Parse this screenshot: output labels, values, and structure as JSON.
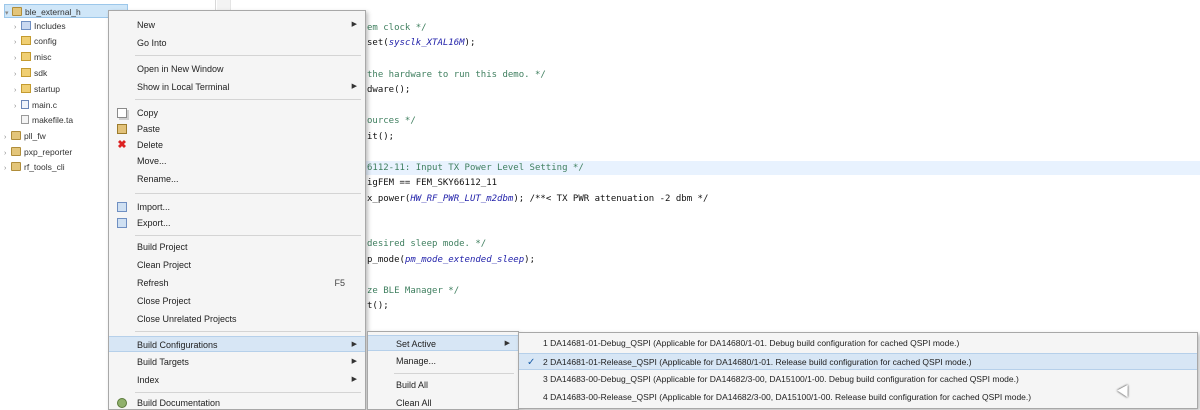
{
  "explorer": {
    "items": [
      {
        "label": "ble_external_h",
        "icon": "project-icon",
        "twisty": "▾"
      },
      {
        "label": "Includes",
        "icon": "include-icon",
        "twisty": "›"
      },
      {
        "label": "config",
        "icon": "folder-icon",
        "twisty": "›"
      },
      {
        "label": "misc",
        "icon": "folder-icon",
        "twisty": "›"
      },
      {
        "label": "sdk",
        "icon": "folder-icon",
        "twisty": "›"
      },
      {
        "label": "startup",
        "icon": "folder-icon",
        "twisty": "›"
      },
      {
        "label": "main.c",
        "icon": "c-file-icon",
        "twisty": "›"
      },
      {
        "label": "makefile.ta",
        "icon": "file-icon",
        "twisty": ""
      },
      {
        "label": "pll_fw",
        "icon": "project-icon",
        "twisty": "›"
      },
      {
        "label": "pxp_reporter",
        "icon": "project-icon",
        "twisty": "›"
      },
      {
        "label": "rf_tools_cli",
        "icon": "project-icon",
        "twisty": "›"
      }
    ]
  },
  "editor": {
    "lines": [
      {
        "text": "em clock */",
        "kind": "comment"
      },
      {
        "text": "set(",
        "kw": "sysclk_XTAL16M",
        "tail": ");",
        "kind": "code"
      },
      {
        "text": "",
        "kind": "code"
      },
      {
        "text": "the hardware to run this demo. */",
        "kind": "comment"
      },
      {
        "text": "dware();",
        "kind": "code"
      },
      {
        "text": "",
        "kind": "code"
      },
      {
        "text": "ources */",
        "kind": "comment"
      },
      {
        "text": "it();",
        "kind": "code"
      },
      {
        "text": "",
        "kind": "code"
      },
      {
        "text": "6112-11: Input TX Power Level Setting */",
        "kind": "comment",
        "highlight": true
      },
      {
        "text": "igFEM == FEM_SKY66112_11",
        "kind": "code"
      },
      {
        "text": "x_power(",
        "kw": "HW_RF_PWR_LUT_m2dbm",
        "tail": "); /**< TX PWR attenuation -2 dbm */",
        "kind": "code"
      },
      {
        "text": "",
        "kind": "code"
      },
      {
        "text": "",
        "kind": "code"
      },
      {
        "text": "desired sleep mode. */",
        "kind": "comment"
      },
      {
        "text": "p_mode(",
        "kw": "pm_mode_extended_sleep",
        "tail": ");",
        "kind": "code"
      },
      {
        "text": "",
        "kind": "code"
      },
      {
        "text": "ze BLE Manager */",
        "kind": "comment"
      },
      {
        "text": "t();",
        "kind": "code"
      }
    ]
  },
  "context_menu": {
    "items": [
      {
        "label": "New",
        "has_submenu": true
      },
      {
        "label": "Go Into"
      },
      {
        "separator": true
      },
      {
        "label": "Open in New Window"
      },
      {
        "label": "Show in Local Terminal",
        "has_submenu": true
      },
      {
        "separator": true
      },
      {
        "label": "Copy",
        "icon": "copy-icon"
      },
      {
        "label": "Paste",
        "icon": "paste-icon"
      },
      {
        "label": "Delete",
        "icon": "delete-icon"
      },
      {
        "label": "Move..."
      },
      {
        "label": "Rename..."
      },
      {
        "separator": true
      },
      {
        "label": "Import...",
        "icon": "import-icon"
      },
      {
        "label": "Export...",
        "icon": "export-icon"
      },
      {
        "separator": true
      },
      {
        "label": "Build Project"
      },
      {
        "label": "Clean Project"
      },
      {
        "label": "Refresh",
        "accel": "F5"
      },
      {
        "label": "Close Project"
      },
      {
        "label": "Close Unrelated Projects"
      },
      {
        "separator": true
      },
      {
        "label": "Build Configurations",
        "has_submenu": true,
        "hover": true
      },
      {
        "label": "Build Targets",
        "has_submenu": true
      },
      {
        "label": "Index",
        "has_submenu": true
      },
      {
        "separator": true
      },
      {
        "label": "Build Documentation",
        "icon": "documentation-icon"
      }
    ]
  },
  "build_config_menu": {
    "items": [
      {
        "label": "Set Active",
        "has_submenu": true,
        "hover": true
      },
      {
        "label": "Manage..."
      },
      {
        "separator": true
      },
      {
        "label": "Build All"
      },
      {
        "label": "Clean All"
      }
    ]
  },
  "set_active_menu": {
    "items": [
      {
        "label": "1 DA14681-01-Debug_QSPI (Applicable for DA14680/1-01. Debug build configuration for cached QSPI mode.)",
        "checked": false
      },
      {
        "label": "2 DA14681-01-Release_QSPI (Applicable for DA14680/1-01. Release build configuration for cached QSPI mode.)",
        "checked": true,
        "hover": true
      },
      {
        "label": "3 DA14683-00-Debug_QSPI (Applicable for DA14682/3-00, DA15100/1-00. Debug build configuration for cached QSPI mode.)",
        "checked": false
      },
      {
        "label": "4 DA14683-00-Release_QSPI (Applicable for DA14682/3-00, DA15100/1-00. Release build configuration for cached QSPI mode.)",
        "checked": false
      }
    ],
    "check_glyph": "✓"
  },
  "colors": {
    "selection": "#cfe6f8",
    "menu_hover": "#d7e6f5",
    "comment": "#3f7f5f",
    "keyword": "#2222aa"
  }
}
